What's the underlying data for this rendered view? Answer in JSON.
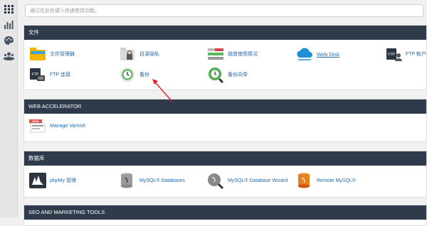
{
  "sidebar": {
    "items": [
      {
        "icon": "grid-icon"
      },
      {
        "icon": "stats-icon"
      },
      {
        "icon": "palette-icon"
      },
      {
        "icon": "users-icon"
      }
    ]
  },
  "search": {
    "placeholder": "通过在此处键入快速查找功能。"
  },
  "sections": {
    "files": {
      "title": "文件",
      "items": [
        {
          "label": "文件管理器",
          "icon": "file-manager-icon"
        },
        {
          "label": "目录隐私",
          "icon": "directory-privacy-icon"
        },
        {
          "label": "磁盘使用情况",
          "icon": "disk-usage-icon"
        },
        {
          "label": "Web Disk",
          "icon": "web-disk-icon"
        },
        {
          "label": "FTP 帐户",
          "icon": "ftp-accounts-icon"
        },
        {
          "label": "FTP 连接",
          "icon": "ftp-connections-icon"
        },
        {
          "label": "备份",
          "icon": "backup-icon"
        },
        {
          "label": "备份向导",
          "icon": "backup-wizard-icon"
        }
      ]
    },
    "web_accelerator": {
      "title": "WEB ACCELERATOR",
      "items": [
        {
          "label": "Manage Varnish",
          "icon": "varnish-icon",
          "badge": "NEW"
        }
      ]
    },
    "database": {
      "title": "数据库",
      "items": [
        {
          "label": "phpMy 管理",
          "icon": "phpmyadmin-icon"
        },
        {
          "label": "MySQL® Databases",
          "icon": "mysql-databases-icon"
        },
        {
          "label": "MySQL® Database Wizard",
          "icon": "mysql-wizard-icon"
        },
        {
          "label": "Remote MySQL®",
          "icon": "remote-mysql-icon"
        }
      ]
    },
    "seo": {
      "title": "SEO AND MARKETING TOOLS"
    }
  },
  "colors": {
    "header_bg": "#2f3b4a",
    "link": "#2a6aa8",
    "annotation_arrow": "#e02020"
  }
}
